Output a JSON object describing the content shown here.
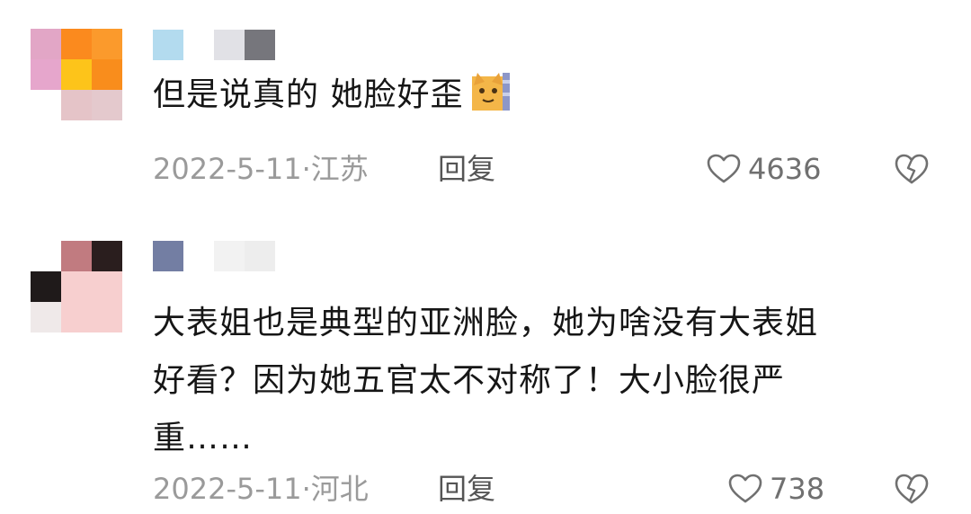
{
  "comments": [
    {
      "text": "但是说真的 她脸好歪",
      "emoji": "cat-emoji-icon",
      "date": "2022-5-11",
      "location": "江苏",
      "reply_label": "回复",
      "likes": "4636"
    },
    {
      "text_lines": [
        "大表姐也是典型的亚洲脸，她为啥没有大表姐",
        "好看？因为她五官太不对称了！大小脸很严",
        "重……"
      ],
      "date": "2022-5-11",
      "location": "河北",
      "reply_label": "回复",
      "likes": "738"
    }
  ],
  "meta_separator": "·",
  "icons": {
    "like": "heart-outline-icon",
    "dislike": "broken-heart-icon"
  },
  "colors": {
    "text": "#161616",
    "meta": "#9a9a9a",
    "reply": "#555555",
    "icon": "#707070"
  }
}
